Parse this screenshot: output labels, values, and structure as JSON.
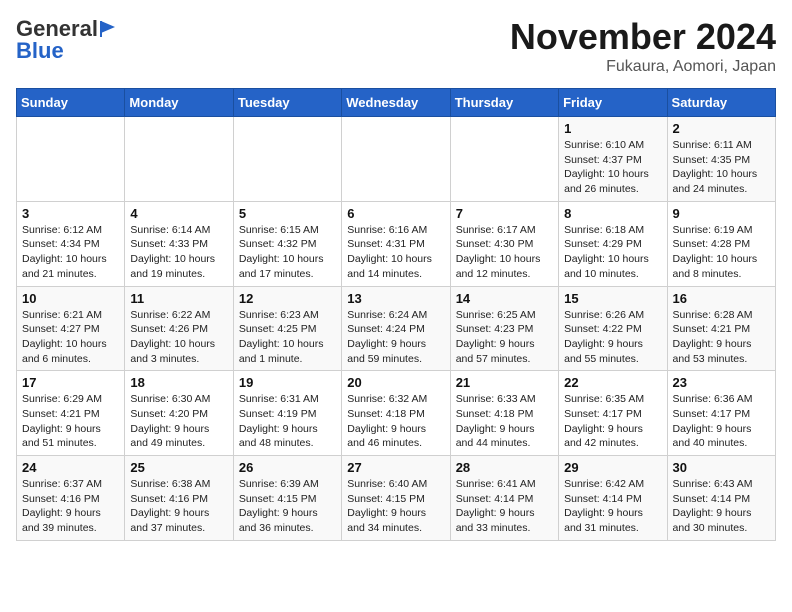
{
  "header": {
    "logo_general": "General",
    "logo_blue": "Blue",
    "month_title": "November 2024",
    "location": "Fukaura, Aomori, Japan"
  },
  "days_of_week": [
    "Sunday",
    "Monday",
    "Tuesday",
    "Wednesday",
    "Thursday",
    "Friday",
    "Saturday"
  ],
  "weeks": [
    [
      {
        "day": "",
        "detail": ""
      },
      {
        "day": "",
        "detail": ""
      },
      {
        "day": "",
        "detail": ""
      },
      {
        "day": "",
        "detail": ""
      },
      {
        "day": "",
        "detail": ""
      },
      {
        "day": "1",
        "detail": "Sunrise: 6:10 AM\nSunset: 4:37 PM\nDaylight: 10 hours and 26 minutes."
      },
      {
        "day": "2",
        "detail": "Sunrise: 6:11 AM\nSunset: 4:35 PM\nDaylight: 10 hours and 24 minutes."
      }
    ],
    [
      {
        "day": "3",
        "detail": "Sunrise: 6:12 AM\nSunset: 4:34 PM\nDaylight: 10 hours and 21 minutes."
      },
      {
        "day": "4",
        "detail": "Sunrise: 6:14 AM\nSunset: 4:33 PM\nDaylight: 10 hours and 19 minutes."
      },
      {
        "day": "5",
        "detail": "Sunrise: 6:15 AM\nSunset: 4:32 PM\nDaylight: 10 hours and 17 minutes."
      },
      {
        "day": "6",
        "detail": "Sunrise: 6:16 AM\nSunset: 4:31 PM\nDaylight: 10 hours and 14 minutes."
      },
      {
        "day": "7",
        "detail": "Sunrise: 6:17 AM\nSunset: 4:30 PM\nDaylight: 10 hours and 12 minutes."
      },
      {
        "day": "8",
        "detail": "Sunrise: 6:18 AM\nSunset: 4:29 PM\nDaylight: 10 hours and 10 minutes."
      },
      {
        "day": "9",
        "detail": "Sunrise: 6:19 AM\nSunset: 4:28 PM\nDaylight: 10 hours and 8 minutes."
      }
    ],
    [
      {
        "day": "10",
        "detail": "Sunrise: 6:21 AM\nSunset: 4:27 PM\nDaylight: 10 hours and 6 minutes."
      },
      {
        "day": "11",
        "detail": "Sunrise: 6:22 AM\nSunset: 4:26 PM\nDaylight: 10 hours and 3 minutes."
      },
      {
        "day": "12",
        "detail": "Sunrise: 6:23 AM\nSunset: 4:25 PM\nDaylight: 10 hours and 1 minute."
      },
      {
        "day": "13",
        "detail": "Sunrise: 6:24 AM\nSunset: 4:24 PM\nDaylight: 9 hours and 59 minutes."
      },
      {
        "day": "14",
        "detail": "Sunrise: 6:25 AM\nSunset: 4:23 PM\nDaylight: 9 hours and 57 minutes."
      },
      {
        "day": "15",
        "detail": "Sunrise: 6:26 AM\nSunset: 4:22 PM\nDaylight: 9 hours and 55 minutes."
      },
      {
        "day": "16",
        "detail": "Sunrise: 6:28 AM\nSunset: 4:21 PM\nDaylight: 9 hours and 53 minutes."
      }
    ],
    [
      {
        "day": "17",
        "detail": "Sunrise: 6:29 AM\nSunset: 4:21 PM\nDaylight: 9 hours and 51 minutes."
      },
      {
        "day": "18",
        "detail": "Sunrise: 6:30 AM\nSunset: 4:20 PM\nDaylight: 9 hours and 49 minutes."
      },
      {
        "day": "19",
        "detail": "Sunrise: 6:31 AM\nSunset: 4:19 PM\nDaylight: 9 hours and 48 minutes."
      },
      {
        "day": "20",
        "detail": "Sunrise: 6:32 AM\nSunset: 4:18 PM\nDaylight: 9 hours and 46 minutes."
      },
      {
        "day": "21",
        "detail": "Sunrise: 6:33 AM\nSunset: 4:18 PM\nDaylight: 9 hours and 44 minutes."
      },
      {
        "day": "22",
        "detail": "Sunrise: 6:35 AM\nSunset: 4:17 PM\nDaylight: 9 hours and 42 minutes."
      },
      {
        "day": "23",
        "detail": "Sunrise: 6:36 AM\nSunset: 4:17 PM\nDaylight: 9 hours and 40 minutes."
      }
    ],
    [
      {
        "day": "24",
        "detail": "Sunrise: 6:37 AM\nSunset: 4:16 PM\nDaylight: 9 hours and 39 minutes."
      },
      {
        "day": "25",
        "detail": "Sunrise: 6:38 AM\nSunset: 4:16 PM\nDaylight: 9 hours and 37 minutes."
      },
      {
        "day": "26",
        "detail": "Sunrise: 6:39 AM\nSunset: 4:15 PM\nDaylight: 9 hours and 36 minutes."
      },
      {
        "day": "27",
        "detail": "Sunrise: 6:40 AM\nSunset: 4:15 PM\nDaylight: 9 hours and 34 minutes."
      },
      {
        "day": "28",
        "detail": "Sunrise: 6:41 AM\nSunset: 4:14 PM\nDaylight: 9 hours and 33 minutes."
      },
      {
        "day": "29",
        "detail": "Sunrise: 6:42 AM\nSunset: 4:14 PM\nDaylight: 9 hours and 31 minutes."
      },
      {
        "day": "30",
        "detail": "Sunrise: 6:43 AM\nSunset: 4:14 PM\nDaylight: 9 hours and 30 minutes."
      }
    ]
  ]
}
